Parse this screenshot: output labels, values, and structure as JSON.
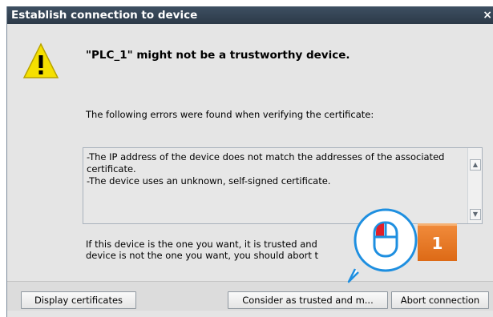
{
  "dialog": {
    "title": "Establish connection to device",
    "close_glyph": "×",
    "icon": "warning-icon",
    "heading": "\"PLC_1\" might not be a trustworthy device.",
    "intro": "The following errors were found when verifying the certificate:",
    "errors": [
      "-The IP address of the device does not match the addresses of the associated certificate.",
      "-The device uses an unknown, self-signed certificate."
    ],
    "note_visible_parts": [
      "If this device is the one you want, it is trusted and",
      "is",
      "device is not the one you want, you should abort t"
    ]
  },
  "scrollbar": {
    "up_glyph": "▲",
    "down_glyph": "▼"
  },
  "buttons": {
    "display_certificates": "Display certificates",
    "consider_trusted": "Consider as trusted and m...",
    "abort_connection": "Abort connection"
  },
  "overlay": {
    "icon": "mouse-click-icon",
    "step_number": "1",
    "colors": {
      "badge": "#e8771f",
      "mouse_outline": "#1e8fe0",
      "mouse_button": "#e0202a"
    }
  }
}
